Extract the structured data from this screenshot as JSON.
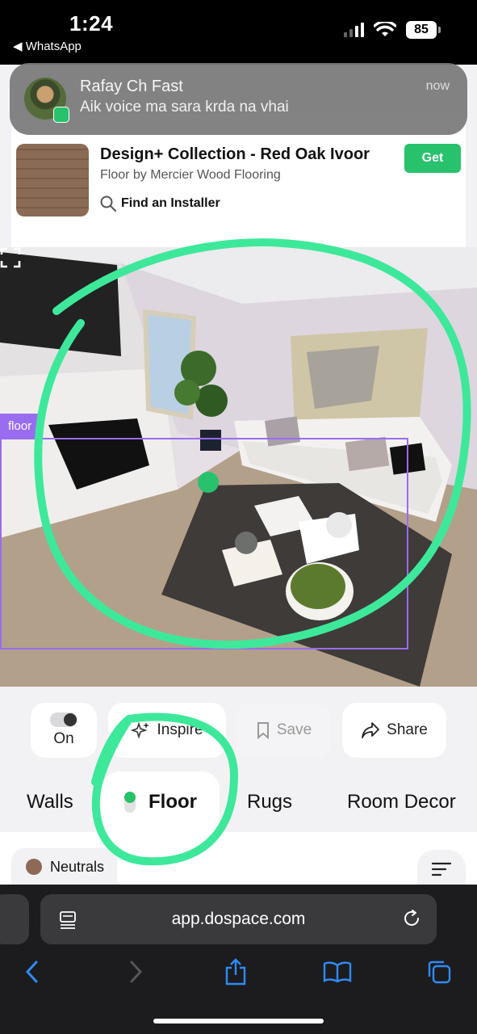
{
  "status_bar": {
    "time": "1:24",
    "back_app": "◀ WhatsApp",
    "battery": "85"
  },
  "notification": {
    "sender": "Rafay Ch Fast",
    "message": "Aik voice ma sara krda na vhai",
    "time": "now",
    "app_icon": "whatsapp-icon"
  },
  "product": {
    "title": "Design+ Collection - Red Oak Ivoor",
    "subtitle": "Floor by Mercier Wood Flooring",
    "get_label": "Get",
    "installer_label": "Find an Installer"
  },
  "scene": {
    "detection_label": "floor"
  },
  "toolbar": {
    "on_label": "On",
    "inspire_label": "Inspire",
    "save_label": "Save",
    "share_label": "Share"
  },
  "tabs": [
    {
      "label": "Walls"
    },
    {
      "label": "Floor"
    },
    {
      "label": "Rugs"
    },
    {
      "label": "Room Decor"
    }
  ],
  "filters": {
    "chip_label": "Neutrals",
    "chip_color": "#8c6a56"
  },
  "browser": {
    "url": "app.dospace.com"
  },
  "colors": {
    "accent_green": "#27c26b",
    "annotation_green": "#3ee89a",
    "detection_purple": "#9a6cf0"
  }
}
